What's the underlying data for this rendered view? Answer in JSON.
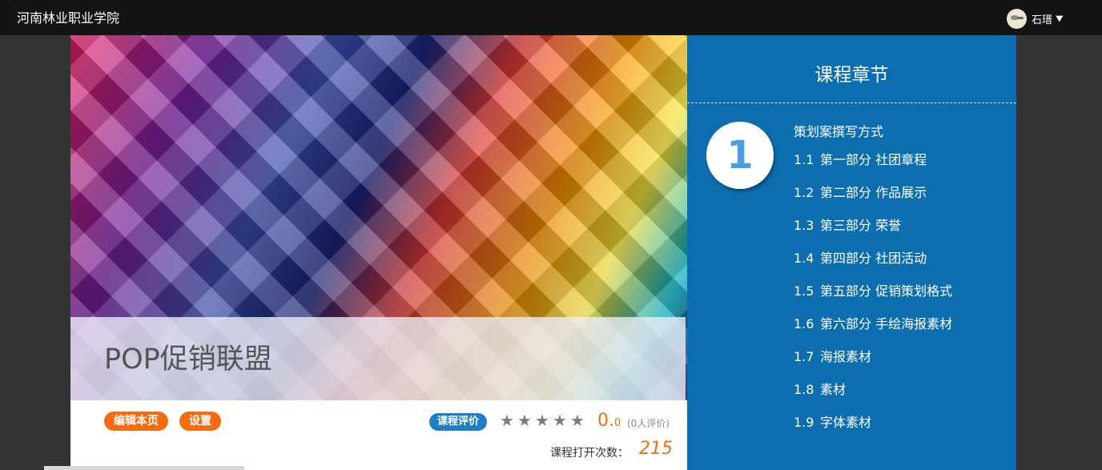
{
  "header": {
    "site_title": "河南林业职业学院",
    "user_name": "石瑨"
  },
  "course": {
    "title": "POP促销联盟",
    "actions": {
      "edit": "编辑本页",
      "settings": "设置"
    },
    "rating": {
      "button": "课程评价",
      "score_int": "0.",
      "score_dec": "0",
      "reviews": "(0人评价)",
      "stars": 0,
      "stars_max": 5
    },
    "opens": {
      "label": "课程打开次数：",
      "value": "215"
    }
  },
  "chapters": {
    "heading": "课程章节",
    "current": {
      "number": "1",
      "title": "策划案撰写方式",
      "sections": [
        {
          "num": "1.1",
          "label": "第一部分 社团章程"
        },
        {
          "num": "1.2",
          "label": "第二部分 作品展示"
        },
        {
          "num": "1.3",
          "label": "第三部分 荣誉"
        },
        {
          "num": "1.4",
          "label": "第四部分 社团活动"
        },
        {
          "num": "1.5",
          "label": "第五部分 促销策划格式"
        },
        {
          "num": "1.6",
          "label": "第六部分 手绘海报素材"
        },
        {
          "num": "1.7",
          "label": "海报素材"
        },
        {
          "num": "1.8",
          "label": "素材"
        },
        {
          "num": "1.9",
          "label": "字体素材"
        }
      ]
    }
  },
  "colors": {
    "accent_orange": "#f36c10",
    "panel_blue": "#0d6eaf",
    "rate_blue": "#1e7fc6"
  }
}
